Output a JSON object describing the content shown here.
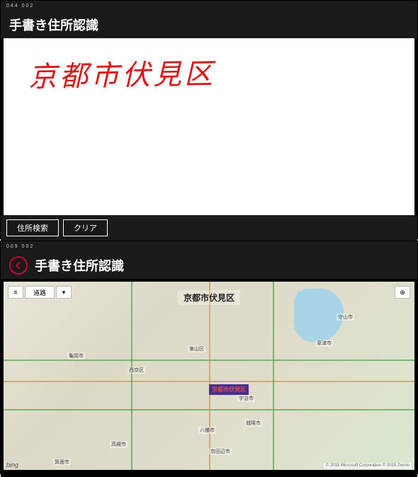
{
  "top_window": {
    "counter": "044  002",
    "title": "手書き住所認識",
    "handwritten_text": "京都市伏見区",
    "buttons": {
      "search": "住所検索",
      "clear": "クリア"
    }
  },
  "bottom_window": {
    "counter": "009  002",
    "title": "手書き住所認識",
    "map": {
      "location_label": "京都市伏見区",
      "pin_label": "京都市伏見区",
      "controls": {
        "menu": "≡",
        "road_view": "道路",
        "dropdown": "▾",
        "locate": "⊕"
      },
      "places": {
        "higashiyama": "東山区",
        "nishikyo": "西京区",
        "uji": "宇治市",
        "kusatsu": "草津市",
        "moriyama": "守山市",
        "yawata": "八幡市",
        "kameoka": "亀岡市",
        "joyo": "城陽市",
        "takatsuki": "高槻市",
        "kyotanabe": "京田辺市",
        "minoh": "箕面市"
      },
      "provider": "bing",
      "attribution": "© 2015 Microsoft Corporation © 2015 Zenrin"
    }
  }
}
